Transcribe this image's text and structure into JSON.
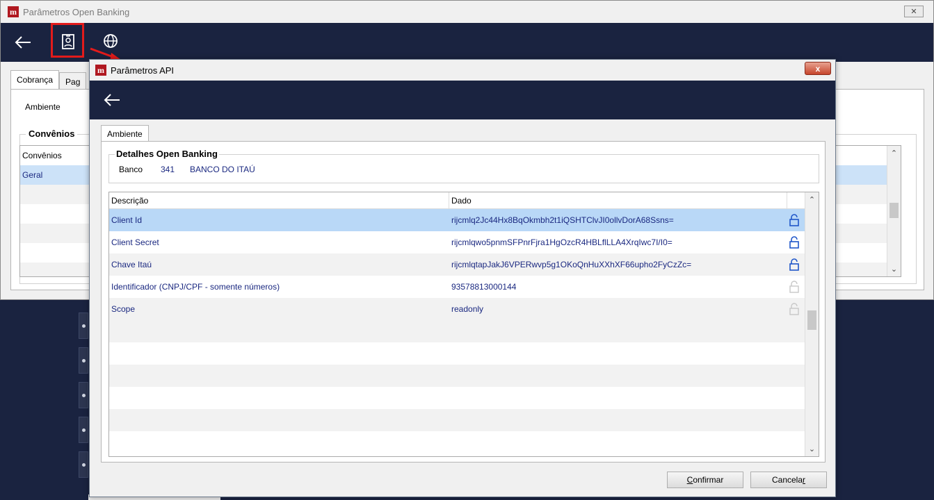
{
  "main_window": {
    "title": "Parâmetros Open Banking",
    "close_label": "✕",
    "toolbar": {
      "back_icon": "arrow-left-icon",
      "badge_icon": "id-badge-icon",
      "globe_icon": "globe-icon"
    },
    "tabs": [
      {
        "label": "Cobrança"
      },
      {
        "label": "Pag"
      }
    ],
    "ambiente_label": "Ambiente",
    "group_title": "Convênios",
    "list": {
      "header": "Convênios",
      "rows": [
        "Geral"
      ]
    }
  },
  "dialog": {
    "title": "Parâmetros API",
    "close_label": "x",
    "tab_label": "Ambiente",
    "group_title": "Detalhes Open Banking",
    "banco": {
      "label": "Banco",
      "code": "341",
      "name": "BANCO DO ITAÚ"
    },
    "grid": {
      "columns": [
        "Descrição",
        "Dado"
      ],
      "rows": [
        {
          "descricao": "Client Id",
          "dado": "rijcmlq2Jc44Hx8BqOkmbh2t1iQSHTClvJI0ollvDorA68Ssns=",
          "locked": true
        },
        {
          "descricao": "Client Secret",
          "dado": "rijcmlqwo5pnmSFPnrFjra1HgOzcR4HBLflLLA4XrqIwc7I/I0=",
          "locked": true
        },
        {
          "descricao": "Chave Itaú",
          "dado": "rijcmlqtapJakJ6VPERwvp5g1OKoQnHuXXhXF66upho2FyCzZc=",
          "locked": true
        },
        {
          "descricao": "Identificador (CNPJ/CPF - somente números)",
          "dado": "93578813000144",
          "locked": false
        },
        {
          "descricao": "Scope",
          "dado": "readonly",
          "locked": false
        }
      ]
    },
    "buttons": {
      "confirm_prefix": "",
      "confirm_hotkey": "C",
      "confirm_rest": "onfirmar",
      "cancel_prefix": "Cancela",
      "cancel_hotkey": "r",
      "cancel_rest": ""
    }
  },
  "colors": {
    "toolbar_bg": "#1a2340",
    "selection": "#b9d8f7",
    "value_text": "#1a2880",
    "highlight": "#e31b1b"
  }
}
